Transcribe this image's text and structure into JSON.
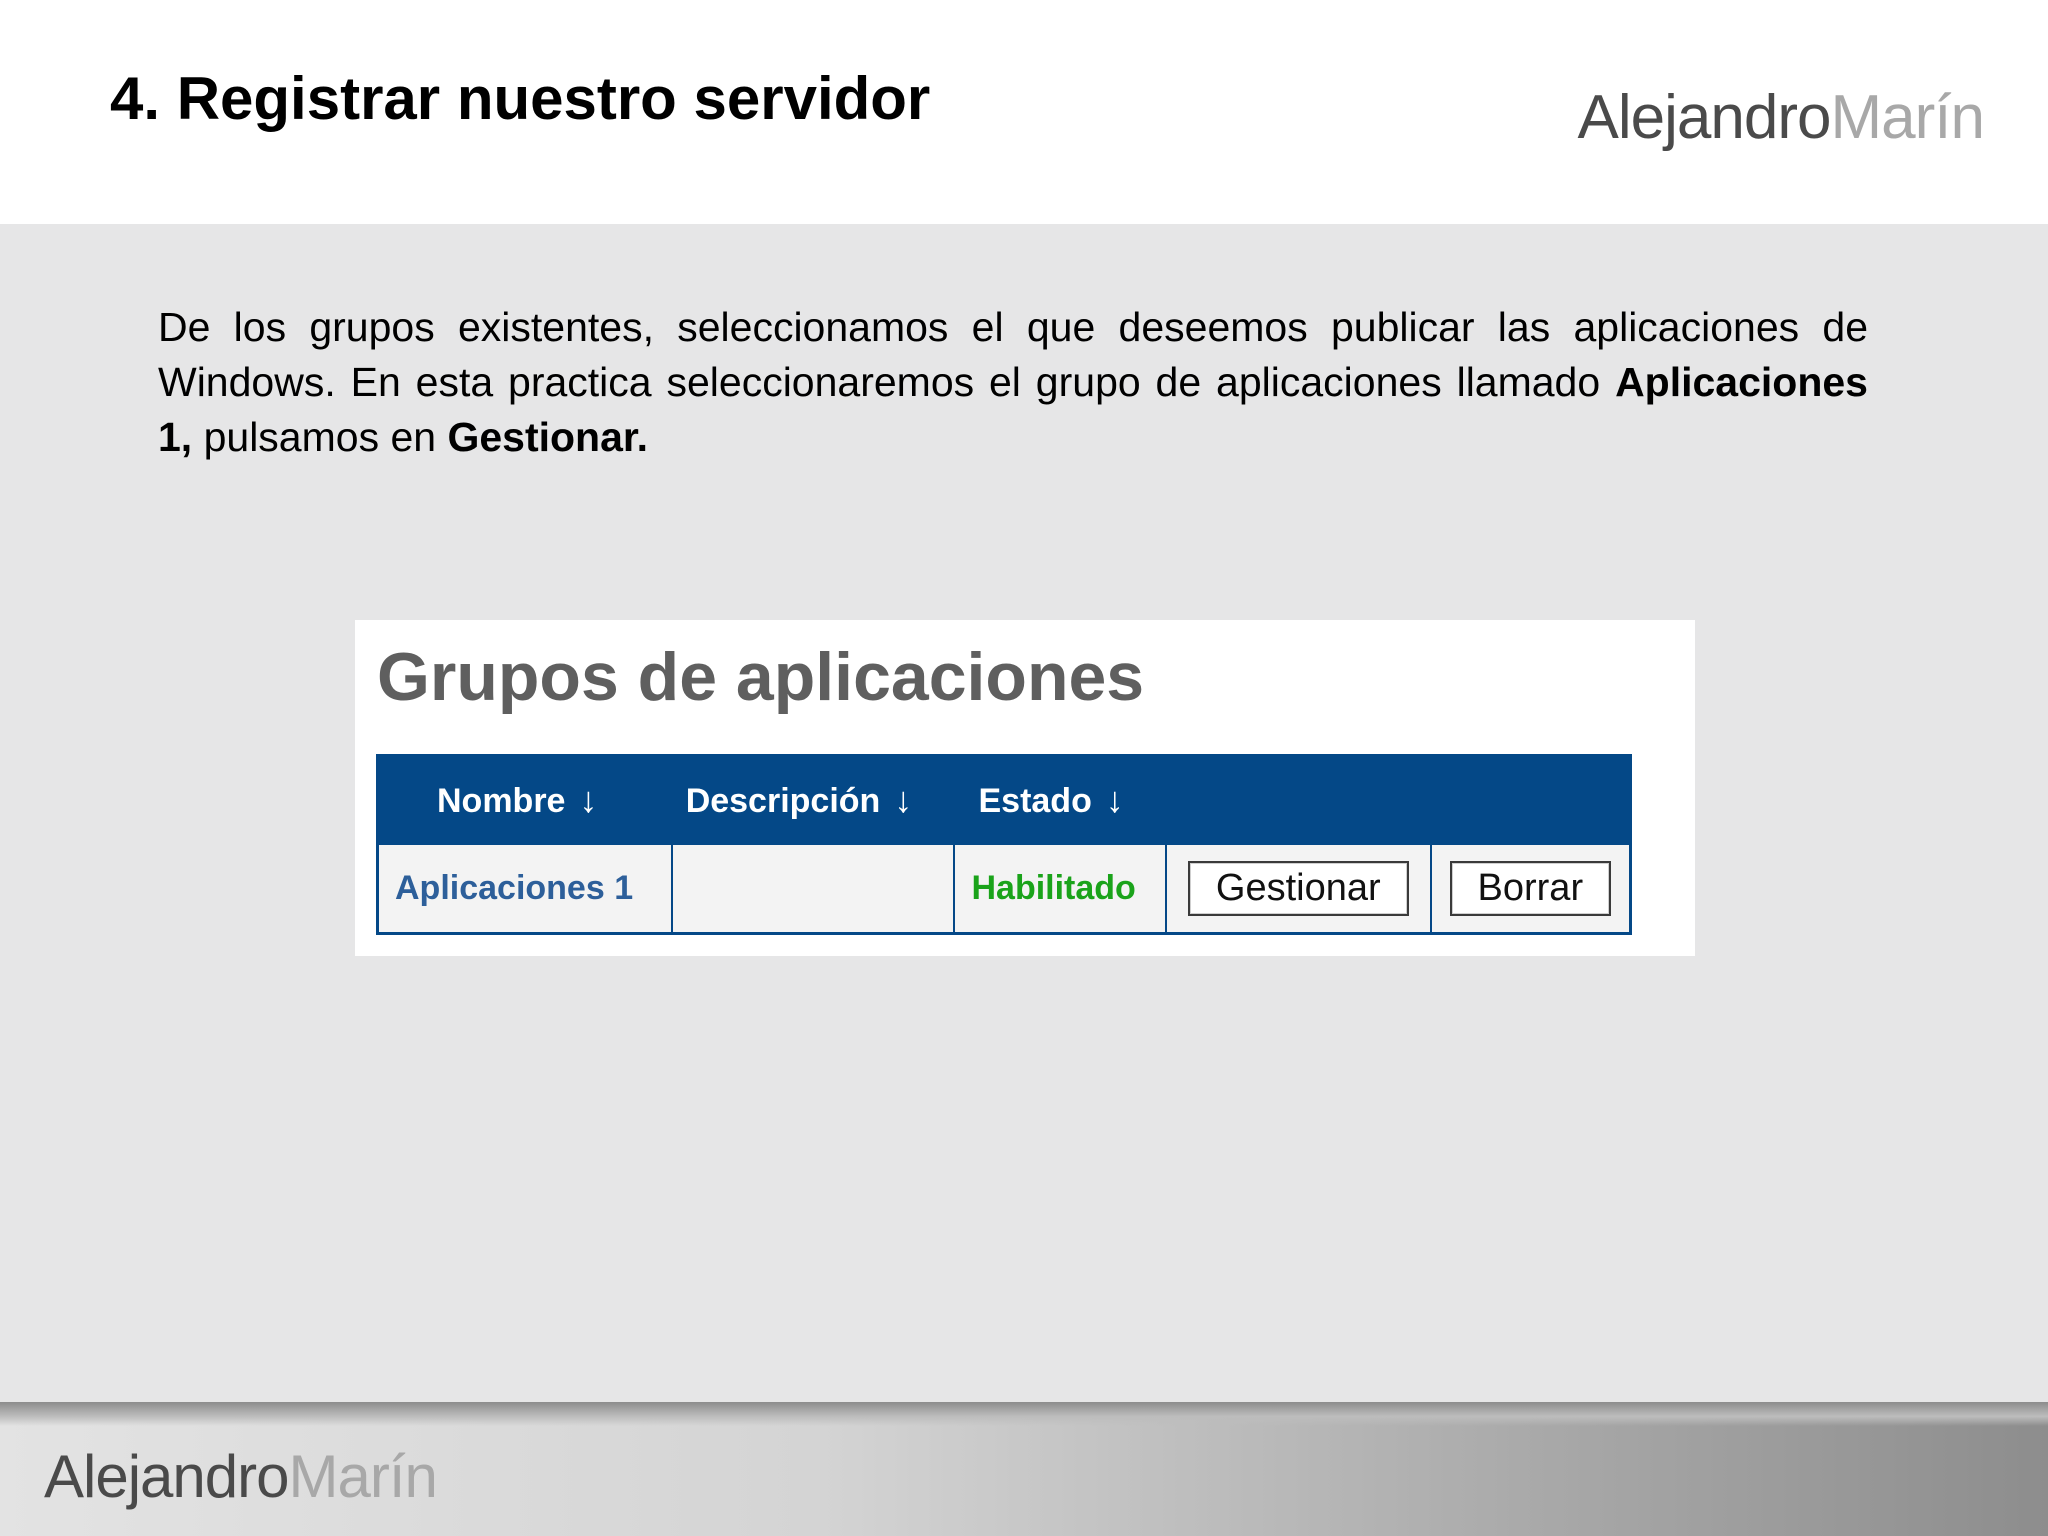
{
  "slide": {
    "title": "4. Registrar nuestro servidor",
    "logo": {
      "first": "Alejandro",
      "last": "Marín"
    },
    "paragraph": {
      "part1": "De los grupos existentes, seleccionamos el que deseemos publicar las aplicaciones de Windows. En esta practica seleccionaremos el grupo de aplicaciones llamado ",
      "bold1": "Aplicaciones 1,",
      "part2": " pulsamos en ",
      "bold2": "Gestionar."
    }
  },
  "screenshot": {
    "title": "Grupos de aplicaciones",
    "columns": [
      {
        "label": "Nombre",
        "sort_icon": "↓"
      },
      {
        "label": "Descripción",
        "sort_icon": "↓"
      },
      {
        "label": "Estado",
        "sort_icon": "↓"
      }
    ],
    "rows": [
      {
        "name": "Aplicaciones 1",
        "description": "",
        "status": "Habilitado",
        "manage_label": "Gestionar",
        "delete_label": "Borrar"
      }
    ]
  },
  "colors": {
    "table_header": "#044887",
    "status_enabled": "#1aa31a",
    "link": "#2d5f9a",
    "logo_dark": "#4a4a4a",
    "logo_light": "#a8a8a8"
  }
}
